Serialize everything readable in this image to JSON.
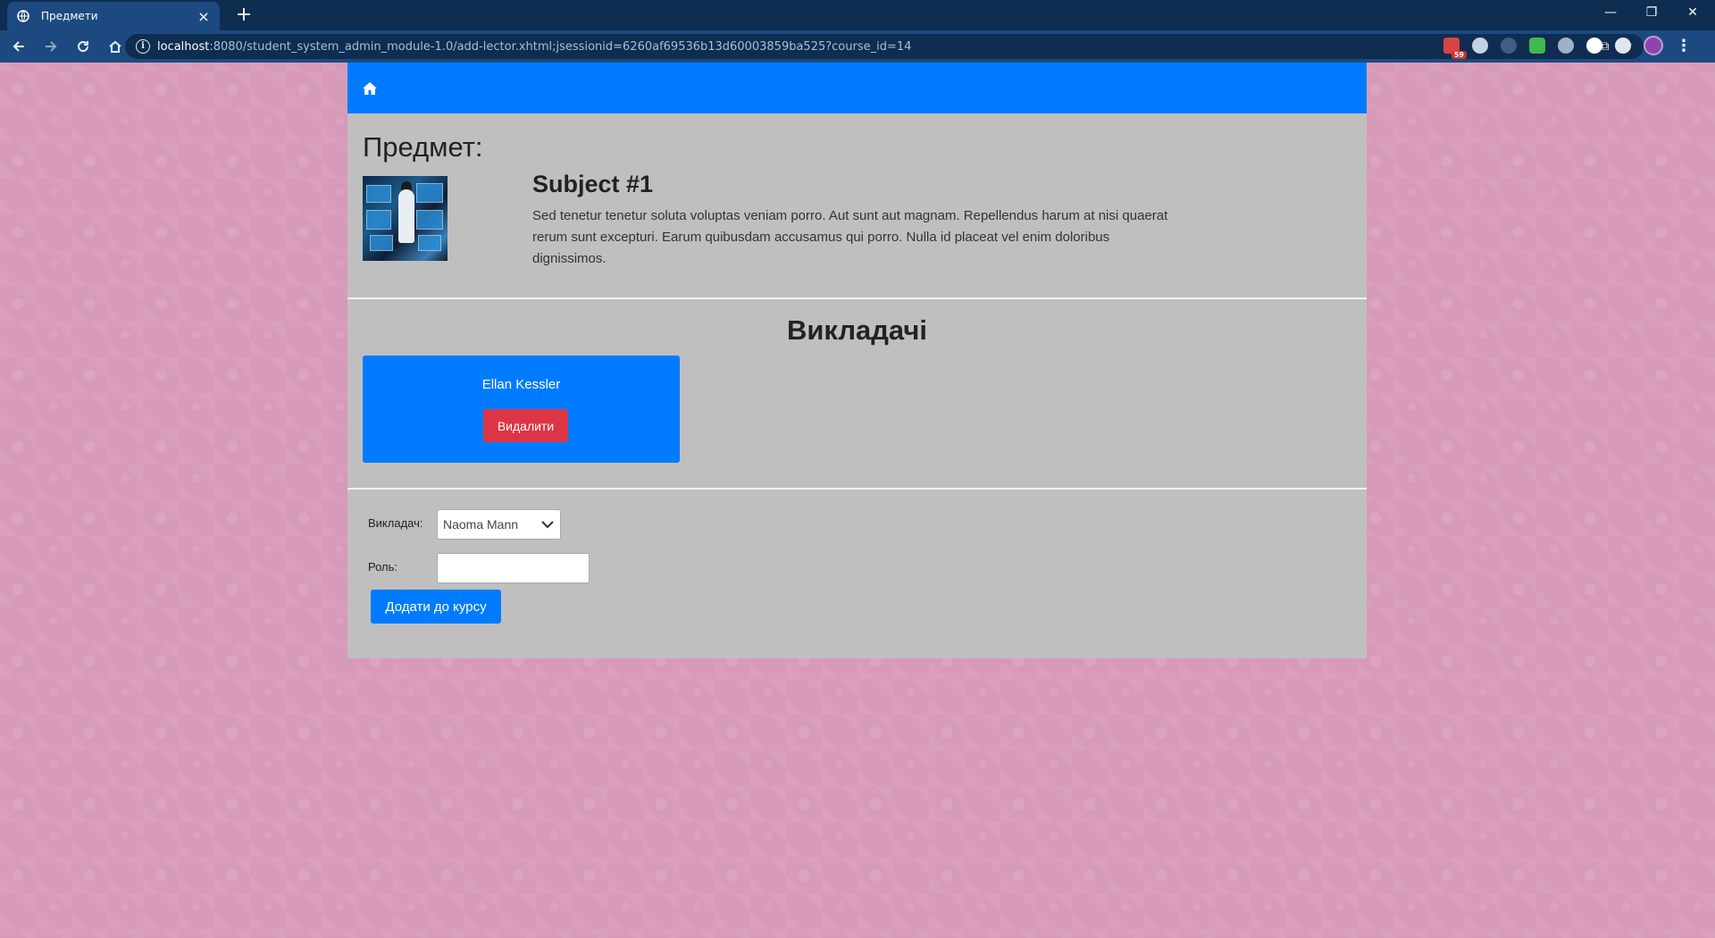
{
  "browser": {
    "tab_title": "Предмети",
    "url_host": "localhost",
    "url_rest": ":8080/student_system_admin_module-1.0/add-lector.xhtml;jsessionid=6260af69536b13d60003859ba525?course_id=14",
    "extension_badge": "59"
  },
  "subject": {
    "heading": "Предмет:",
    "title": "Subject #1",
    "description": "Sed tenetur tenetur soluta voluptas veniam porro. Aut sunt aut magnam. Repellendus harum at nisi quaerat rerum sunt excepturi. Earum quibusdam accusamus qui porro. Nulla id placeat vel enim doloribus dignissimos."
  },
  "lecturers": {
    "heading": "Викладачі",
    "items": [
      {
        "name": "Ellan Kessler",
        "delete_label": "Видалити"
      }
    ]
  },
  "form": {
    "lecturer_label": "Викладач:",
    "lecturer_selected": "Naoma Mann",
    "role_label": "Роль:",
    "role_value": "",
    "submit_label": "Додати до курсу"
  },
  "colors": {
    "primary": "#007bff",
    "danger": "#dc3545",
    "panel": "#bfbfbf",
    "background": "#d79ab8"
  }
}
